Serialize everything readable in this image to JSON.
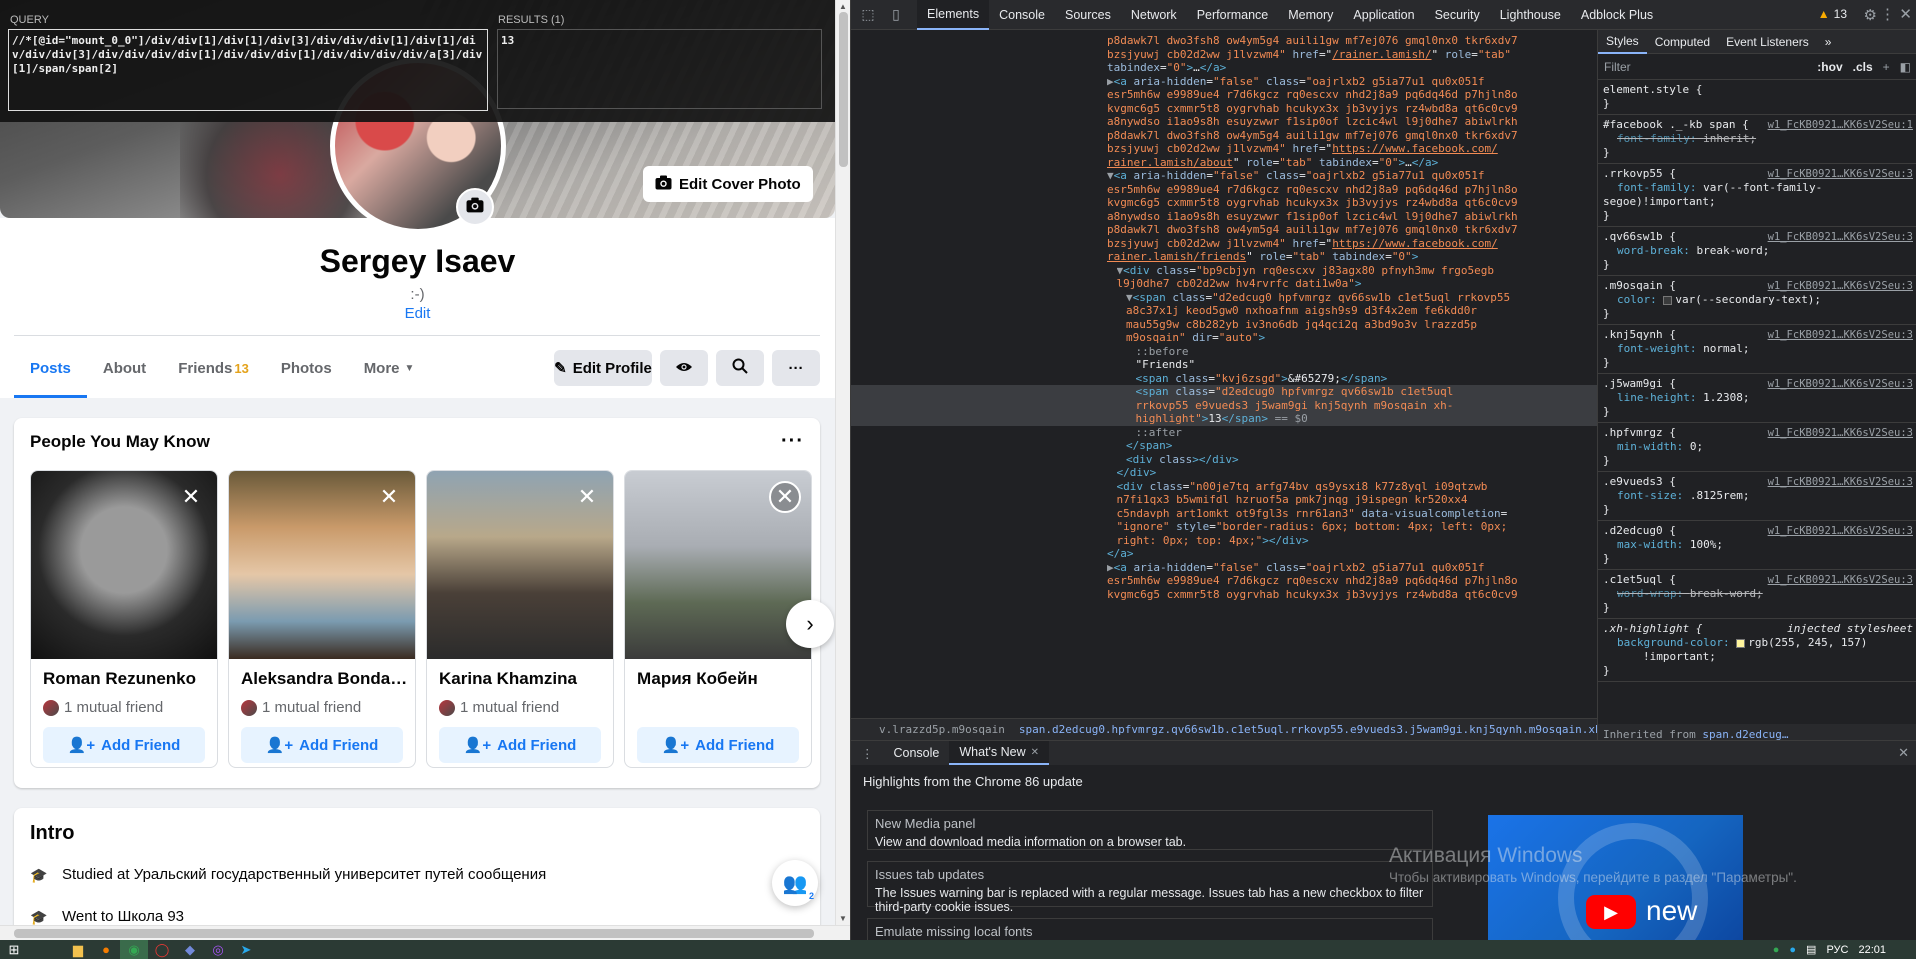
{
  "xpath_tool": {
    "query_label": "QUERY",
    "query": "//*[@id=\"mount_0_0\"]/div/div[1]/div[1]/div[3]/div/div/div[1]/div[1]/div/div/div[3]/div/div/div/div[1]/div/div/div[1]/div/div/div/div/a[3]/div[1]/span/span[2]",
    "results_label": "RESULTS (1)",
    "result": "13"
  },
  "profile": {
    "edit_cover": "Edit Cover Photo",
    "name": "Sergey Isaev",
    "bio": ":-)",
    "bio_edit": "Edit",
    "tabs": [
      {
        "label": "Posts"
      },
      {
        "label": "About"
      },
      {
        "label": "Friends",
        "count": "13"
      },
      {
        "label": "Photos"
      },
      {
        "label": "More"
      }
    ],
    "edit_profile": "Edit Profile"
  },
  "pymk": {
    "title": "People You May Know",
    "people": [
      {
        "name": "Roman Rezunenko",
        "mutual": "1 mutual friend",
        "add": "Add Friend",
        "colors": [
          "#9a9a9a",
          "#222222"
        ]
      },
      {
        "name": "Aleksandra Bondar...",
        "mutual": "1 mutual friend",
        "add": "Add Friend",
        "colors": [
          "#c99a6a",
          "#3a2a20"
        ]
      },
      {
        "name": "Karina Khamzina",
        "mutual": "1 mutual friend",
        "add": "Add Friend",
        "colors": [
          "#b8a88a",
          "#4a4038"
        ]
      },
      {
        "name": "Мария Кобейн",
        "mutual": "",
        "add": "Add Friend",
        "colors": [
          "#c8ccd2",
          "#5e6a55"
        ]
      }
    ]
  },
  "intro": {
    "title": "Intro",
    "items": [
      "Studied at Уральский государственный университет путей сообщения",
      "Went to Школа 93"
    ],
    "chat_badge": "2"
  },
  "devtools": {
    "tabs": [
      "Elements",
      "Console",
      "Sources",
      "Network",
      "Performance",
      "Memory",
      "Application",
      "Security",
      "Lighthouse",
      "Adblock Plus"
    ],
    "warnings": "13",
    "breadcrumbs": [
      "v.lrazzd5p.m9osqain",
      "span.d2edcug0.hpfvmrgz.qv66sw1b.c1et5uql.rrkovp55.e9vueds3.j5wam9gi.knj5qynh.m9osqain.xh-highlight"
    ],
    "styles_tabs": [
      "Styles",
      "Computed",
      "Event Listeners"
    ],
    "filter_placeholder": "Filter",
    "hov": ":hov",
    "cls": ".cls",
    "rules": [
      {
        "sel": "element.style {",
        "src": "",
        "props": []
      },
      {
        "sel": "#facebook ._-kb span {",
        "src": "w1_FcKB0921…KK6sV2Seu:1",
        "props": [
          {
            "p": "font-family",
            "v": "inherit;",
            "strike": true
          }
        ]
      },
      {
        "sel": ".rrkovp55 {",
        "src": "w1_FcKB0921…KK6sV2Seu:3",
        "props": [
          {
            "p": "font-family",
            "v": "var(--font-family-segoe)!important;"
          }
        ]
      },
      {
        "sel": ".qv66sw1b {",
        "src": "w1_FcKB0921…KK6sV2Seu:3",
        "props": [
          {
            "p": "word-break",
            "v": "break-word;"
          }
        ]
      },
      {
        "sel": ".m9osqain {",
        "src": "w1_FcKB0921…KK6sV2Seu:3",
        "props": [
          {
            "p": "color",
            "v": "var(--secondary-text);",
            "swatch": "#3a3b3c"
          }
        ]
      },
      {
        "sel": ".knj5qynh {",
        "src": "w1_FcKB0921…KK6sV2Seu:3",
        "props": [
          {
            "p": "font-weight",
            "v": "normal;"
          }
        ]
      },
      {
        "sel": ".j5wam9gi {",
        "src": "w1_FcKB0921…KK6sV2Seu:3",
        "props": [
          {
            "p": "line-height",
            "v": "1.2308;"
          }
        ]
      },
      {
        "sel": ".hpfvmrgz {",
        "src": "w1_FcKB0921…KK6sV2Seu:3",
        "props": [
          {
            "p": "min-width",
            "v": "0;"
          }
        ]
      },
      {
        "sel": ".e9vueds3 {",
        "src": "w1_FcKB0921…KK6sV2Seu:3",
        "props": [
          {
            "p": "font-size",
            "v": ".8125rem;"
          }
        ]
      },
      {
        "sel": ".d2edcug0 {",
        "src": "w1_FcKB0921…KK6sV2Seu:3",
        "props": [
          {
            "p": "max-width",
            "v": "100%;"
          }
        ]
      },
      {
        "sel": ".c1et5uql {",
        "src": "w1_FcKB0921…KK6sV2Seu:3",
        "props": [
          {
            "p": "word-wrap",
            "v": "break-word;",
            "strike": true
          }
        ]
      },
      {
        "sel": ".xh-highlight {",
        "src": "injected stylesheet",
        "injected": true,
        "props": [
          {
            "p": "background-color",
            "v": "rgb(255, 245, 157)",
            "swatch": "#fff59d"
          },
          {
            "p": "",
            "v": "!important;"
          }
        ]
      }
    ],
    "inherited_label": "Inherited from",
    "inherited_sel": "span.d2edcug…",
    "drawer_tabs": [
      "Console",
      "What's New"
    ],
    "whats_new_title": "Highlights from the Chrome 86 update",
    "whats_new_items": [
      {
        "title": "New Media panel",
        "desc": "View and download media information on a browser tab."
      },
      {
        "title": "Issues tab updates",
        "desc": "The Issues warning bar is replaced with a regular message. Issues tab has a new checkbox to filter third-party cookie issues."
      },
      {
        "title": "Emulate missing local fonts",
        "desc": ""
      }
    ],
    "video_text": "new",
    "activation_title": "Активация Windows",
    "activation_text": "Чтобы активировать Windows, перейдите в раздел \"Параметры\"."
  },
  "taskbar": {
    "lang": "РУС",
    "time": "22:01"
  },
  "dom_lines": [
    {
      "i": 0,
      "h": "<span class=\"aval\">p8dawk7l dwo3fsh8 ow4ym5g4 auili1gw mf7ej076 gmql0nx0 tkr6xdv7</span>"
    },
    {
      "i": 0,
      "h": "<span class=\"aval\">bzsjyuwj cb02d2ww j1lvzwm4\"</span> <span class=\"attr\">href</span>=\"<span class=\"aval\" style=\"text-decoration:underline\">/rainer.lamish/</span>\" <span class=\"attr\">role</span>=<span class=\"aval\">\"tab\"</span>"
    },
    {
      "i": 0,
      "h": "<span class=\"attr\">tabindex</span>=<span class=\"aval\">\"0\"</span><span class=\"tag\">&gt;</span>…<span class=\"tag\">&lt;/a&gt;</span>"
    },
    {
      "i": 0,
      "h": "<span class=\"pseudo\">▶</span><span class=\"tag\">&lt;a</span> <span class=\"attr\">aria-hidden</span>=<span class=\"aval\">\"false\"</span> <span class=\"attr\">class</span>=<span class=\"aval\">\"oajrlxb2 g5ia77u1 qu0x051f</span>"
    },
    {
      "i": 0,
      "h": "<span class=\"aval\">esr5mh6w e9989ue4 r7d6kgcz rq0escxv nhd2j8a9 pq6dq46d p7hjln8o</span>"
    },
    {
      "i": 0,
      "h": "<span class=\"aval\">kvgmc6g5 cxmmr5t8 oygrvhab hcukyx3x jb3vyjys rz4wbd8a qt6c0cv9</span>"
    },
    {
      "i": 0,
      "h": "<span class=\"aval\">a8nywdso i1ao9s8h esuyzwwr f1sip0of lzcic4wl l9j0dhe7 abiwlrkh</span>"
    },
    {
      "i": 0,
      "h": "<span class=\"aval\">p8dawk7l dwo3fsh8 ow4ym5g4 auili1gw mf7ej076 gmql0nx0 tkr6xdv7</span>"
    },
    {
      "i": 0,
      "h": "<span class=\"aval\">bzsjyuwj cb02d2ww j1lvzwm4\"</span> <span class=\"attr\">href</span>=\"<span class=\"aval\" style=\"text-decoration:underline\">https://www.facebook.com/</span>"
    },
    {
      "i": 0,
      "h": "<span class=\"aval\" style=\"text-decoration:underline\">rainer.lamish/about</span>\" <span class=\"attr\">role</span>=<span class=\"aval\">\"tab\"</span> <span class=\"attr\">tabindex</span>=<span class=\"aval\">\"0\"</span><span class=\"tag\">&gt;</span>…<span class=\"tag\">&lt;/a&gt;</span>"
    },
    {
      "i": 0,
      "h": "<span class=\"pseudo\">▼</span><span class=\"tag\">&lt;a</span> <span class=\"attr\">aria-hidden</span>=<span class=\"aval\">\"false\"</span> <span class=\"attr\">class</span>=<span class=\"aval\">\"oajrlxb2 g5ia77u1 qu0x051f</span>"
    },
    {
      "i": 0,
      "h": "<span class=\"aval\">esr5mh6w e9989ue4 r7d6kgcz rq0escxv nhd2j8a9 pq6dq46d p7hjln8o</span>"
    },
    {
      "i": 0,
      "h": "<span class=\"aval\">kvgmc6g5 cxmmr5t8 oygrvhab hcukyx3x jb3vyjys rz4wbd8a qt6c0cv9</span>"
    },
    {
      "i": 0,
      "h": "<span class=\"aval\">a8nywdso i1ao9s8h esuyzwwr f1sip0of lzcic4wl l9j0dhe7 abiwlrkh</span>"
    },
    {
      "i": 0,
      "h": "<span class=\"aval\">p8dawk7l dwo3fsh8 ow4ym5g4 auili1gw mf7ej076 gmql0nx0 tkr6xdv7</span>"
    },
    {
      "i": 0,
      "h": "<span class=\"aval\">bzsjyuwj cb02d2ww j1lvzwm4\"</span> <span class=\"attr\">href</span>=\"<span class=\"aval\" style=\"text-decoration:underline\">https://www.facebook.com/</span>"
    },
    {
      "i": 0,
      "h": "<span class=\"aval\" style=\"text-decoration:underline\">rainer.lamish/friends</span>\" <span class=\"attr\">role</span>=<span class=\"aval\">\"tab\"</span> <span class=\"attr\">tabindex</span>=<span class=\"aval\">\"0\"</span><span class=\"tag\">&gt;</span>"
    },
    {
      "i": 1,
      "h": "<span class=\"pseudo\">▼</span><span class=\"tag\">&lt;div</span> <span class=\"attr\">class</span>=<span class=\"aval\">\"bp9cbjyn rq0escxv j83agx80 pfnyh3mw frgo5egb</span>"
    },
    {
      "i": 1,
      "h": "<span class=\"aval\">l9j0dhe7 cb02d2ww hv4rvrfc dati1w0a\"</span><span class=\"tag\">&gt;</span>"
    },
    {
      "i": 2,
      "h": "<span class=\"pseudo\">▼</span><span class=\"tag\">&lt;span</span> <span class=\"attr\">class</span>=<span class=\"aval\">\"d2edcug0 hpfvmrgz qv66sw1b c1et5uql rrkovp55</span>"
    },
    {
      "i": 2,
      "h": "<span class=\"aval\">a8c37x1j keod5gw0 nxhoafnm aigsh9s9 d3f4x2em fe6kdd0r</span>"
    },
    {
      "i": 2,
      "h": "<span class=\"aval\">mau55g9w c8b282yb iv3no6db jq4qci2q a3bd9o3v lrazzd5p</span>"
    },
    {
      "i": 2,
      "h": "<span class=\"aval\">m9osqain\"</span> <span class=\"attr\">dir</span>=<span class=\"aval\">\"auto\"</span><span class=\"tag\">&gt;</span>"
    },
    {
      "i": 3,
      "h": "<span class=\"pseudo\">::before</span>"
    },
    {
      "i": 3,
      "h": "<span class=\"txt\">\"Friends\"</span>"
    },
    {
      "i": 3,
      "h": "<span class=\"tag\">&lt;span</span> <span class=\"attr\">class</span>=<span class=\"aval\">\"kvj6zsgd\"</span><span class=\"tag\">&gt;</span><span class=\"txt\">&amp;#65279;</span><span class=\"tag\">&lt;/span&gt;</span>"
    },
    {
      "i": 3,
      "h": "<span class=\"tag\">&lt;span</span> <span class=\"attr\">class</span>=<span class=\"aval\">\"d2edcug0 hpfvmrgz qv66sw1b c1et5uql</span>",
      "sel": true
    },
    {
      "i": 3,
      "h": "<span class=\"aval\">rrkovp55 e9vueds3 j5wam9gi knj5qynh m9osqain xh-</span>",
      "sel": true
    },
    {
      "i": 3,
      "h": "<span class=\"aval\">highlight\"</span><span class=\"tag\">&gt;</span><span class=\"txt\">13</span><span class=\"tag\">&lt;/span&gt;</span> <span class=\"pseudo\">== $0</span>",
      "sel": true
    },
    {
      "i": 3,
      "h": "<span class=\"pseudo\">::after</span>"
    },
    {
      "i": 2,
      "h": "<span class=\"tag\">&lt;/span&gt;</span>"
    },
    {
      "i": 2,
      "h": "<span class=\"tag\">&lt;div</span> <span class=\"attr\">class</span><span class=\"tag\">&gt;&lt;/div&gt;</span>"
    },
    {
      "i": 1,
      "h": "<span class=\"tag\">&lt;/div&gt;</span>"
    },
    {
      "i": 1,
      "h": "<span class=\"tag\">&lt;div</span> <span class=\"attr\">class</span>=<span class=\"aval\">\"n00je7tq arfg74bv qs9ysxi8 k77z8yql i09qtzwb</span>"
    },
    {
      "i": 1,
      "h": "<span class=\"aval\">n7fi1qx3 b5wmifdl hzruof5a pmk7jnqg j9ispegn kr520xx4</span>"
    },
    {
      "i": 1,
      "h": "<span class=\"aval\">c5ndavph art1omkt ot9fgl3s rnr61an3\"</span> <span class=\"attr\">data-visualcompletion</span>="
    },
    {
      "i": 1,
      "h": "<span class=\"aval\">\"ignore\"</span> <span class=\"attr\">style</span>=<span class=\"aval\">\"border-radius: 6px; bottom: 4px; left: 0px;</span>"
    },
    {
      "i": 1,
      "h": "<span class=\"aval\">right: 0px; top: 4px;\"</span><span class=\"tag\">&gt;&lt;/div&gt;</span>"
    },
    {
      "i": 0,
      "h": "<span class=\"tag\">&lt;/a&gt;</span>"
    },
    {
      "i": 0,
      "h": "<span class=\"pseudo\">▶</span><span class=\"tag\">&lt;a</span> <span class=\"attr\">aria-hidden</span>=<span class=\"aval\">\"false\"</span> <span class=\"attr\">class</span>=<span class=\"aval\">\"oajrlxb2 g5ia77u1 qu0x051f</span>"
    },
    {
      "i": 0,
      "h": "<span class=\"aval\">esr5mh6w e9989ue4 r7d6kgcz rq0escxv nhd2j8a9 pq6dq46d p7hjln8o</span>"
    },
    {
      "i": 0,
      "h": "<span class=\"aval\">kvgmc6g5 cxmmr5t8 oygrvhab hcukyx3x jb3vyjys rz4wbd8a qt6c0cv9</span>"
    }
  ]
}
